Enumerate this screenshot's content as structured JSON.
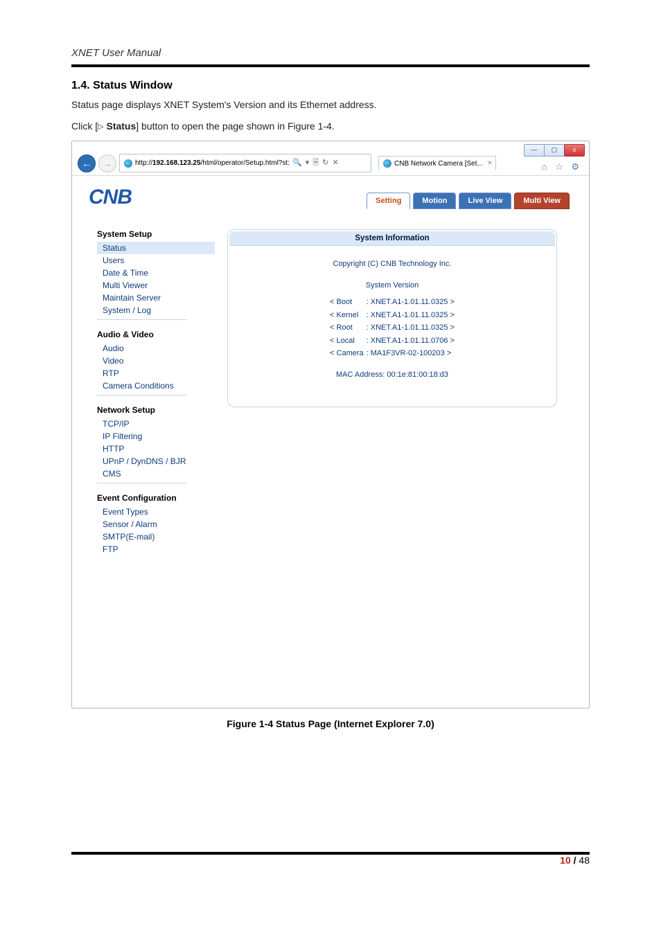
{
  "doc": {
    "header": "XNET User Manual",
    "section_title": "1.4. Status Window",
    "para1": "Status page displays XNET System's Version and its Ethernet address.",
    "para2_pre": "Click [",
    "para2_btn": "Status",
    "para2_post": "] button to open the page shown in Figure 1-4.",
    "figure_caption": "Figure 1-4 Status Page (Internet Explorer 7.0)",
    "page_current": "10",
    "page_sep": " / ",
    "page_total": "48"
  },
  "browser": {
    "win": {
      "min": "—",
      "max": "▢",
      "close": "x"
    },
    "nav_back": "←",
    "nav_fwd": "←",
    "url_prefix": "http://",
    "url_host": "192.168.123.25",
    "url_path": "/html/operator/Setup.html?st:",
    "addr_tools": "🔍 ▾  🗎 ↻ ✕",
    "tab_title": "CNB Network Camera [Set...",
    "tab_close": "✕",
    "page_tools": "⌂ ☆ ⚙"
  },
  "cam": {
    "logo": "CNB",
    "tabs": {
      "setting": "Setting",
      "motion": "Motion",
      "live": "Live View",
      "multi": "Multi View"
    },
    "sidebar": {
      "system_setup": "System Setup",
      "status": "Status",
      "users": "Users",
      "date_time": "Date & Time",
      "multi_viewer": "Multi Viewer",
      "maintain_server": "Maintain Server",
      "system_log": "System / Log",
      "audio_video": "Audio & Video",
      "audio": "Audio",
      "video": "Video",
      "rtp": "RTP",
      "camera_conditions": "Camera Conditions",
      "network_setup": "Network Setup",
      "tcpip": "TCP/IP",
      "ip_filtering": "IP Filtering",
      "http": "HTTP",
      "upnp": "UPnP / DynDNS / BJR",
      "cms": "CMS",
      "event_conf": "Event Configuration",
      "event_types": "Event Types",
      "sensor_alarm": "Sensor / Alarm",
      "smtp": "SMTP(E-mail)",
      "ftp": "FTP"
    },
    "panel": {
      "title": "System Information",
      "copyright": "Copyright (C) CNB Technology Inc.",
      "sysver_label": "System Version",
      "rows": [
        {
          "k": "< Boot",
          "v": ": XNET.A1-1.01.11.0325 >"
        },
        {
          "k": "< Kernel",
          "v": ": XNET.A1-1.01.11.0325 >"
        },
        {
          "k": "< Root",
          "v": ": XNET.A1-1.01.11.0325 >"
        },
        {
          "k": "< Local",
          "v": ": XNET.A1-1.01.11.0706 >"
        },
        {
          "k": "< Camera",
          "v": ": MA1F3VR-02-100203 >"
        }
      ],
      "mac": "MAC Address: 00:1e:81:00:18:d3"
    }
  }
}
